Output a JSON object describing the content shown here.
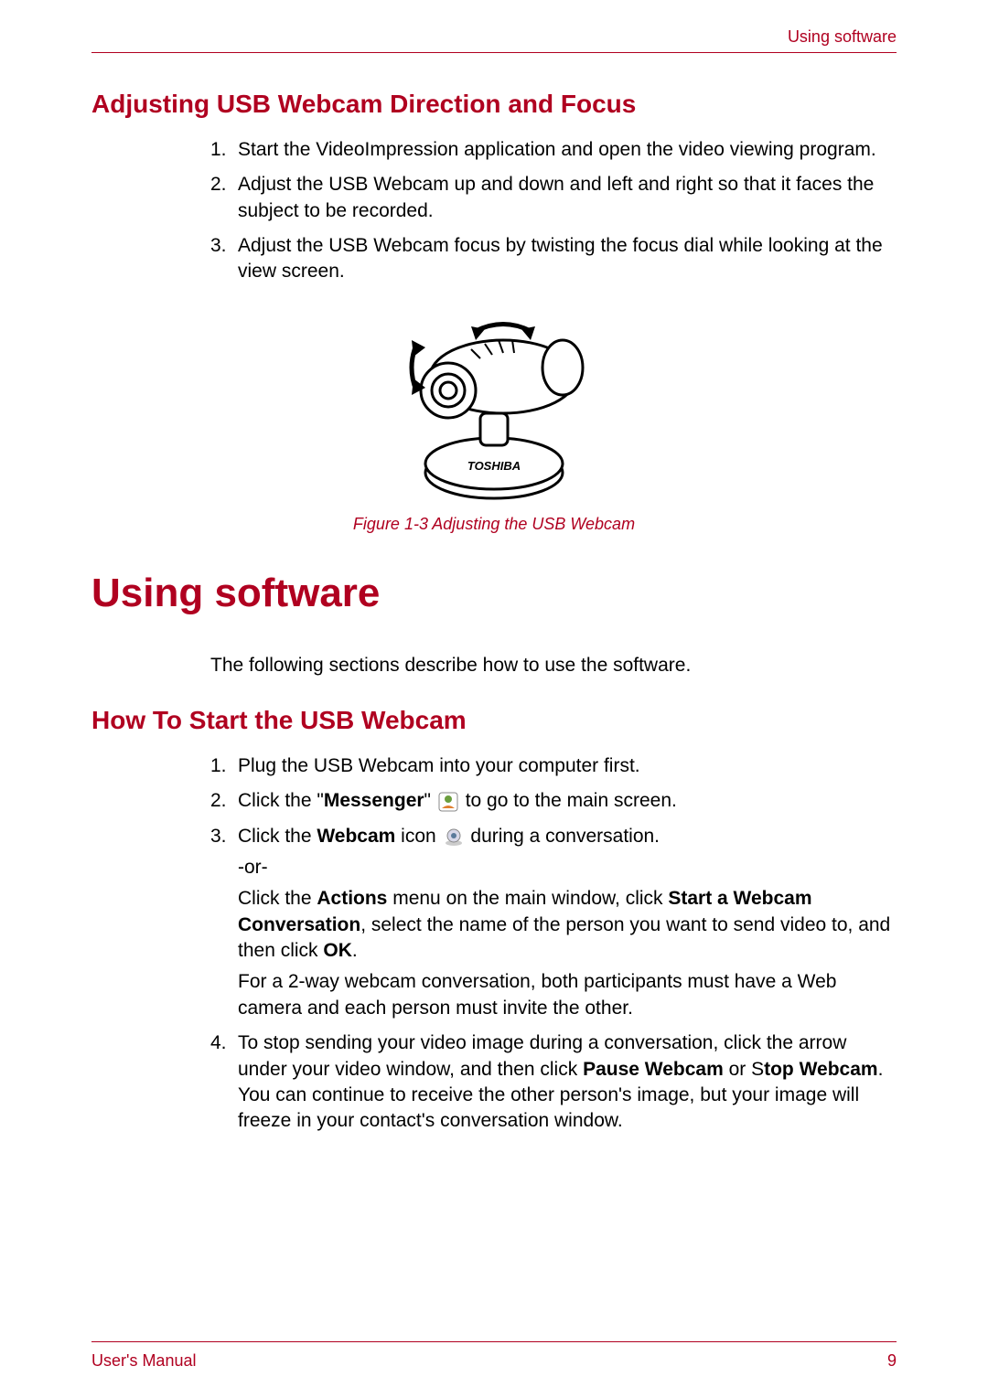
{
  "header": {
    "right_text": "Using software"
  },
  "section1": {
    "heading": "Adjusting USB Webcam Direction and Focus",
    "steps": [
      "Start the VideoImpression application and open the video viewing program.",
      "Adjust the USB Webcam up and down and left and right so that it faces the subject to be recorded.",
      "Adjust the USB Webcam focus by twisting the focus dial while looking at the view screen."
    ],
    "figure_caption": "Figure 1-3 Adjusting the USB Webcam",
    "figure_brand": "TOSHIBA"
  },
  "main_heading": "Using software",
  "intro_para": "The following sections describe how to use the software.",
  "section2": {
    "heading": "How To Start the USB Webcam",
    "step1": "Plug the USB Webcam into your computer first.",
    "step2_pre": "Click the \"",
    "step2_bold": "Messenger",
    "step2_post": "\"",
    "step2_tail": " to go to the main screen.",
    "step3_pre": "Click the ",
    "step3_bold": "Webcam",
    "step3_mid": " icon ",
    "step3_tail": " during a conversation.",
    "step3_or": " -or-",
    "step3_alt_1": "Click the ",
    "step3_alt_b1": "Actions",
    "step3_alt_2": " menu on the main window, click ",
    "step3_alt_b2": "Start a Webcam Conversation",
    "step3_alt_3": ", select the name of the person you want to send video to, and then click ",
    "step3_alt_b3": "OK",
    "step3_alt_4": ".",
    "step3_note": "For a 2-way webcam conversation, both participants must have a Web camera and each person must invite the other.",
    "step4_pre": "To stop sending your video image during a conversation, click the arrow under your video window, and then click ",
    "step4_b1": "Pause Webcam",
    "step4_mid": " or S",
    "step4_b2": "top Webcam",
    "step4_post": ". You can continue to receive the other person's image, but your image will freeze in your contact's conversation window."
  },
  "footer": {
    "left": "User's Manual",
    "right": "9"
  }
}
